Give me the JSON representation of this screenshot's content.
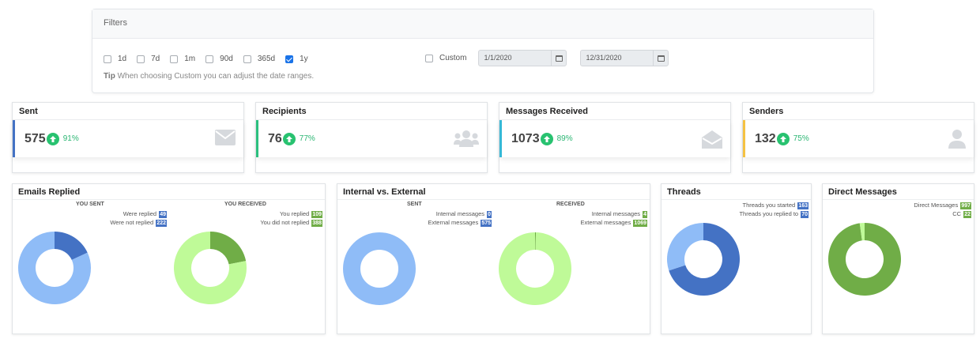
{
  "filters": {
    "title": "Filters",
    "options": [
      {
        "label": "1d",
        "checked": false
      },
      {
        "label": "7d",
        "checked": false
      },
      {
        "label": "1m",
        "checked": false
      },
      {
        "label": "90d",
        "checked": false
      },
      {
        "label": "365d",
        "checked": false
      },
      {
        "label": "1y",
        "checked": true
      }
    ],
    "custom_label": "Custom",
    "start_date": "1/1/2020",
    "end_date": "12/31/2020",
    "tip_label": "Tip",
    "tip_text": "When choosing Custom you can adjust the date ranges."
  },
  "cards": {
    "sent": {
      "title": "Sent",
      "value": "575",
      "pct": "91%",
      "accent": "#4472c4",
      "icon": "envelope-icon"
    },
    "recipients": {
      "title": "Recipients",
      "value": "76",
      "pct": "77%",
      "accent": "#2bc07e",
      "icon": "users-icon"
    },
    "received": {
      "title": "Messages Received",
      "value": "1073",
      "pct": "89%",
      "accent": "#35b8d6",
      "icon": "envelope-open-icon"
    },
    "senders": {
      "title": "Senders",
      "value": "132",
      "pct": "75%",
      "accent": "#f5c242",
      "icon": "user-icon"
    }
  },
  "emails_replied": {
    "title": "Emails Replied",
    "you_sent": {
      "heading": "YOU SENT",
      "replied_label": "Were replied",
      "replied": "49",
      "not_replied_label": "Were not replied",
      "not_replied": "222"
    },
    "you_received": {
      "heading": "YOU RECEIVED",
      "replied_label": "You replied",
      "replied": "109",
      "not_replied_label": "You did not replied",
      "not_replied": "388"
    }
  },
  "internal_external": {
    "title": "Internal vs. External",
    "sent": {
      "heading": "SENT",
      "internal_label": "Internal messages",
      "internal": "0",
      "external_label": "External messages",
      "external": "575"
    },
    "received": {
      "heading": "RECEIVED",
      "internal_label": "Internal messages",
      "internal": "4",
      "external_label": "External messages",
      "external": "1069"
    }
  },
  "threads": {
    "title": "Threads",
    "started_label": "Threads you started",
    "started": "163",
    "replied_label": "Threads you replied to",
    "replied": "70"
  },
  "direct": {
    "title": "Direct Messages",
    "direct_label": "Direct Messages",
    "direct_value": "997",
    "cc_label": "CC",
    "cc_value": "22"
  },
  "colors": {
    "dark_blue": "#4472c4",
    "light_blue": "#8fbcf7",
    "dark_green": "#70ad47",
    "light_green": "#bffa98",
    "up_green": "#28c270"
  }
}
